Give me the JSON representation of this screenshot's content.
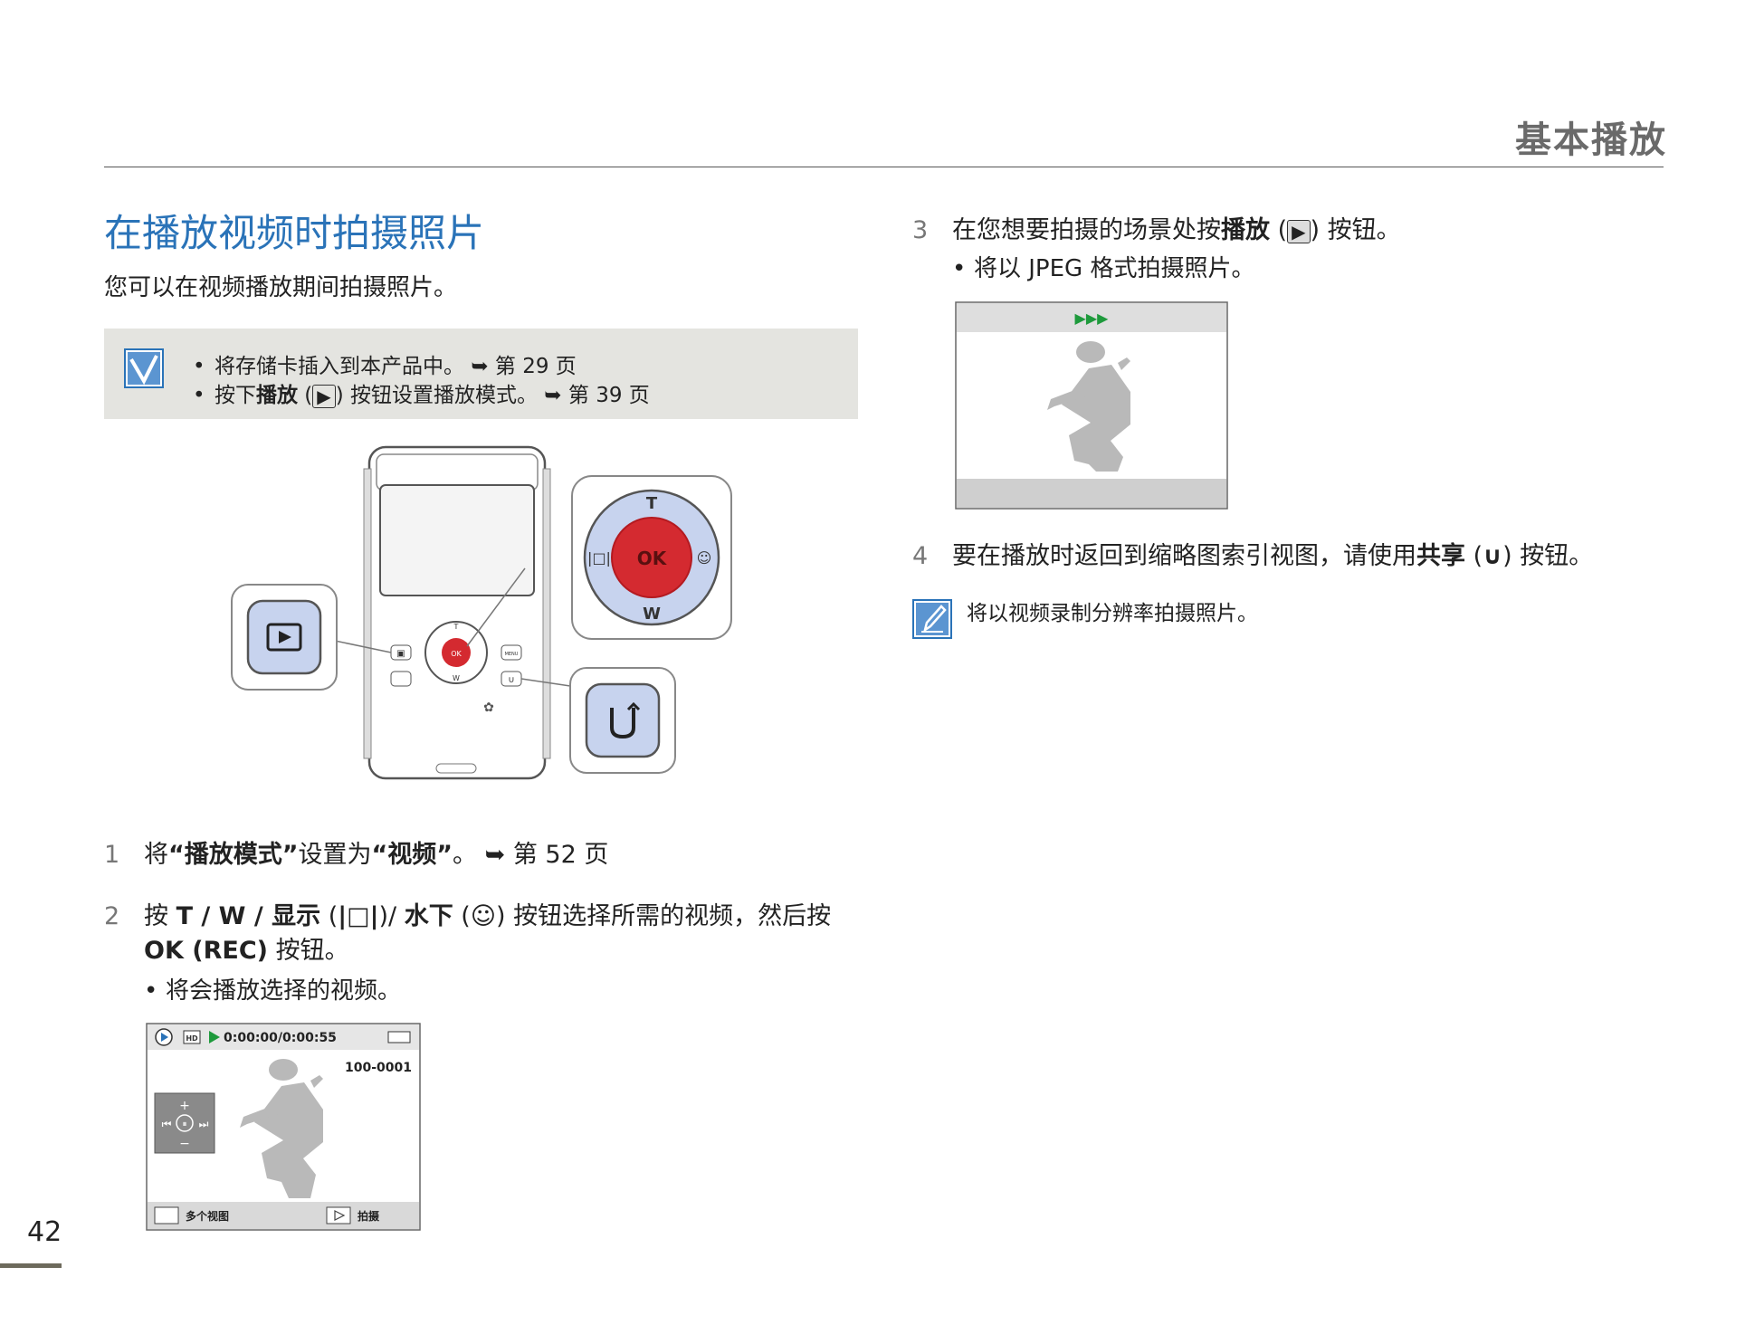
{
  "header": {
    "title": "基本播放"
  },
  "section": {
    "title": "在播放视频时拍摄照片",
    "intro": "您可以在视频播放期间拍摄照片。"
  },
  "note": {
    "line1_text": "将存储卡插入到本产品中。",
    "line1_ref": "第 29 页",
    "line2_pre": "按下",
    "line2_bold": "播放",
    "line2_mid": "按钮设置播放模式。",
    "line2_ref": "第 39 页"
  },
  "device": {
    "ok_label": "OK",
    "t_label": "T",
    "w_label": "W",
    "menu_label": "MENU"
  },
  "steps": {
    "s1": {
      "num": "1",
      "pre": "将",
      "q1": "“播放模式”",
      "mid": "设置为",
      "q2": "“视频”",
      "end": "。",
      "ref": "第  52 页"
    },
    "s2": {
      "num": "2",
      "pre": "按 ",
      "tw": "T / W / ",
      "disp": "显示",
      "under": "水下",
      "post": " 按钮选择所需的视频，然后按",
      "line2_bold": "OK (REC)",
      "line2_post": " 按钮。",
      "bullet": "将会播放选择的视频。"
    },
    "s3": {
      "num": "3",
      "pre": "在您想要拍摄的场景处按",
      "bold": "播放",
      "post": " 按钮。",
      "bullet": "将以 JPEG 格式拍摄照片。"
    },
    "s4": {
      "num": "4",
      "pre": "要在播放时返回到缩略图索引视图，请使用",
      "bold": "共享",
      "post": " 按钮。"
    }
  },
  "screen1": {
    "timecode": "0:00:00/0:00:55",
    "hd": "HD",
    "file_no": "100-0001",
    "left_btn": "多个视图",
    "right_btn": "拍摄"
  },
  "tip": {
    "text": "将以视频录制分辨率拍摄照片。"
  },
  "page": {
    "number": "42"
  },
  "colors": {
    "accent_blue": "#2a73b8",
    "ok_red": "#d42a30",
    "play_green": "#1e9a3c"
  },
  "icons": [
    "checkbox-note-icon",
    "playback-icon",
    "share-icon",
    "pencil-note-icon",
    "arrow-ref-icon",
    "display-icon",
    "underwater-icon"
  ]
}
